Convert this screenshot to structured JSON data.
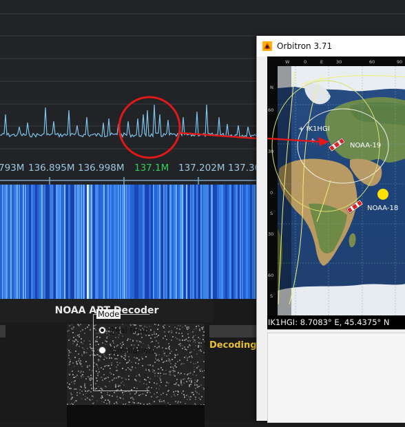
{
  "sdr": {
    "frequency_labels": [
      {
        "text": "793M",
        "active": false
      },
      {
        "text": "136.895M",
        "active": false
      },
      {
        "text": "136.998M",
        "active": false
      },
      {
        "text": "137.1M",
        "active": true
      },
      {
        "text": "137.202M",
        "active": false
      },
      {
        "text": "137.30",
        "active": false
      }
    ],
    "active_frequency_color": "#2ed05a",
    "spectrum_trace_color": "#7cc4ea",
    "waterfall_color": "#1e55c9",
    "highlight_circle_color": "#e01818",
    "arrow_color": "#e01818"
  },
  "decoder": {
    "title": "NOAA APT Decoder",
    "status": "Decoding..."
  },
  "orbitron": {
    "title": "Orbitron 3.71",
    "longitude_ticks": [
      "W",
      "0",
      "E",
      "30",
      "60",
      "90"
    ],
    "latitude_ticks": [
      "N",
      "60",
      "30",
      "0",
      "S",
      "30",
      "60",
      "S"
    ],
    "observer_label": "+ IK1HGI",
    "satellites": [
      {
        "name": "NOAA-19",
        "icon": "satellite-icon"
      },
      {
        "name": "NOAA-18",
        "icon": "satellite-icon"
      }
    ],
    "coordinates": "IK1HGI: 8.7083° E, 45.4375° N",
    "mode": {
      "legend": "Mode",
      "options": [
        {
          "label": "Real time",
          "selected": true
        },
        {
          "label": "Simulation",
          "selected": false
        }
      ]
    }
  }
}
